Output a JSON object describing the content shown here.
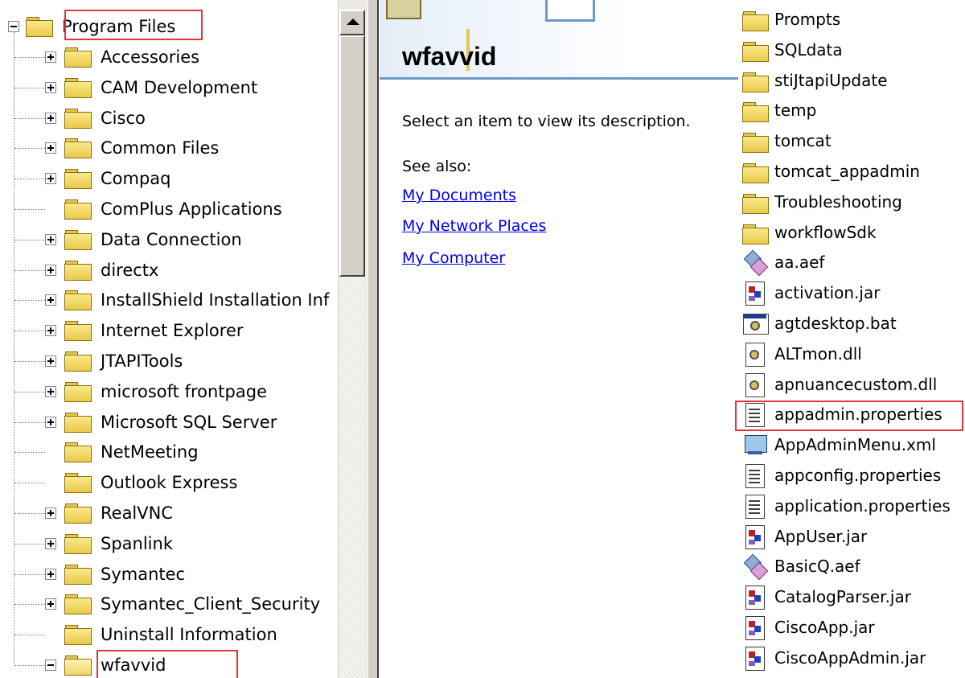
{
  "tree": {
    "root": {
      "label": "Program Files"
    },
    "items": [
      {
        "label": "Accessories",
        "expandable": true
      },
      {
        "label": "CAM Development",
        "expandable": true
      },
      {
        "label": "Cisco",
        "expandable": true
      },
      {
        "label": "Common Files",
        "expandable": true
      },
      {
        "label": "Compaq",
        "expandable": true
      },
      {
        "label": "ComPlus Applications",
        "expandable": false
      },
      {
        "label": "Data Connection",
        "expandable": true
      },
      {
        "label": "directx",
        "expandable": true
      },
      {
        "label": "InstallShield Installation Inf",
        "expandable": true
      },
      {
        "label": "Internet Explorer",
        "expandable": true
      },
      {
        "label": "JTAPITools",
        "expandable": true
      },
      {
        "label": "microsoft frontpage",
        "expandable": true
      },
      {
        "label": "Microsoft SQL Server",
        "expandable": true
      },
      {
        "label": "NetMeeting",
        "expandable": false
      },
      {
        "label": "Outlook Express",
        "expandable": false
      },
      {
        "label": "RealVNC",
        "expandable": true
      },
      {
        "label": "Spanlink",
        "expandable": true
      },
      {
        "label": "Symantec",
        "expandable": true
      },
      {
        "label": "Symantec_Client_Security",
        "expandable": true
      },
      {
        "label": "Uninstall Information",
        "expandable": false
      },
      {
        "label": "wfavvid",
        "expandable": true,
        "expanded": true
      }
    ]
  },
  "info_pane": {
    "folder_title": "wfavvid",
    "description": "Select an item to view its description.",
    "see_also_label": "See also:",
    "links": [
      "My Documents",
      "My Network Places",
      "My Computer"
    ],
    "link_color": "#0000ee"
  },
  "files": [
    {
      "name": "Prompts",
      "icon": "folder"
    },
    {
      "name": "SQLdata",
      "icon": "folder"
    },
    {
      "name": "stiJtapiUpdate",
      "icon": "folder"
    },
    {
      "name": "temp",
      "icon": "folder"
    },
    {
      "name": "tomcat",
      "icon": "folder"
    },
    {
      "name": "tomcat_appadmin",
      "icon": "folder"
    },
    {
      "name": "Troubleshooting",
      "icon": "folder"
    },
    {
      "name": "workflowSdk",
      "icon": "folder"
    },
    {
      "name": "aa.aef",
      "icon": "aef"
    },
    {
      "name": "activation.jar",
      "icon": "jar"
    },
    {
      "name": "agtdesktop.bat",
      "icon": "bat"
    },
    {
      "name": "ALTmon.dll",
      "icon": "dll"
    },
    {
      "name": "apnuancecustom.dll",
      "icon": "dll"
    },
    {
      "name": "appadmin.properties",
      "icon": "txt",
      "highlighted": true
    },
    {
      "name": "AppAdminMenu.xml",
      "icon": "xml"
    },
    {
      "name": "appconfig.properties",
      "icon": "txt"
    },
    {
      "name": "application.properties",
      "icon": "txt"
    },
    {
      "name": "AppUser.jar",
      "icon": "jar"
    },
    {
      "name": "BasicQ.aef",
      "icon": "aef"
    },
    {
      "name": "CatalogParser.jar",
      "icon": "jar"
    },
    {
      "name": "CiscoApp.jar",
      "icon": "jar"
    },
    {
      "name": "CiscoAppAdmin.jar",
      "icon": "jar"
    }
  ],
  "colors": {
    "highlight_box": "#e0363f",
    "folder_fill": "#f3d768",
    "header_rule": "#6e98c8"
  }
}
